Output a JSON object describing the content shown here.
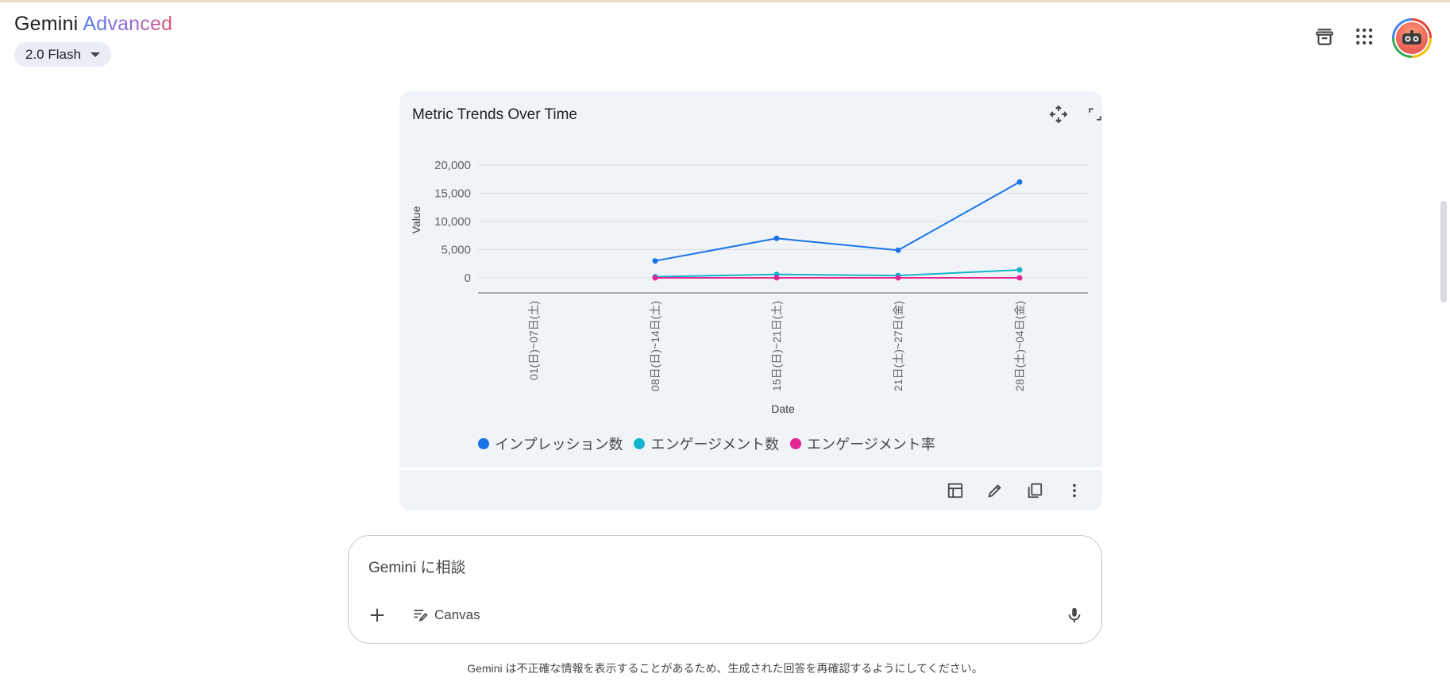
{
  "header": {
    "brand_main": "Gemini",
    "brand_tier": "Advanced",
    "model_label": "2.0 Flash"
  },
  "chart_card": {
    "title": "Metric Trends Over Time",
    "toolbar_icons": [
      "table-icon",
      "edit-icon",
      "copy-icon",
      "more-vert-icon"
    ],
    "header_icons": [
      "move-icon",
      "fullscreen-icon"
    ]
  },
  "chart_data": {
    "type": "line",
    "title": "Metric Trends Over Time",
    "xlabel": "Date",
    "ylabel": "Value",
    "ylim": [
      0,
      20000
    ],
    "yticks": [
      "20,000",
      "15,000",
      "10,000",
      "5,000",
      "0"
    ],
    "categories": [
      "01(日)~07日(土)",
      "08日(日)~14日(土)",
      "15日(日)~21日(土)",
      "21日(土)~27日(金)",
      "28日(土)~04日(金)"
    ],
    "series": [
      {
        "name": "インプレッション数",
        "color": "#1a73e8",
        "values": [
          null,
          3000,
          7000,
          4900,
          17000
        ]
      },
      {
        "name": "エンゲージメント数",
        "color": "#12b5cb",
        "values": [
          null,
          200,
          600,
          400,
          1400
        ]
      },
      {
        "name": "エンゲージメント率",
        "color": "#e52592",
        "values": [
          null,
          5,
          8,
          8,
          8
        ]
      }
    ],
    "legend_position": "bottom",
    "grid": true
  },
  "input": {
    "placeholder": "Gemini に相談",
    "canvas_label": "Canvas"
  },
  "footer": {
    "disclaimer": "Gemini は不正確な情報を表示することがあるため、生成された回答を再確認するようにしてください。"
  }
}
